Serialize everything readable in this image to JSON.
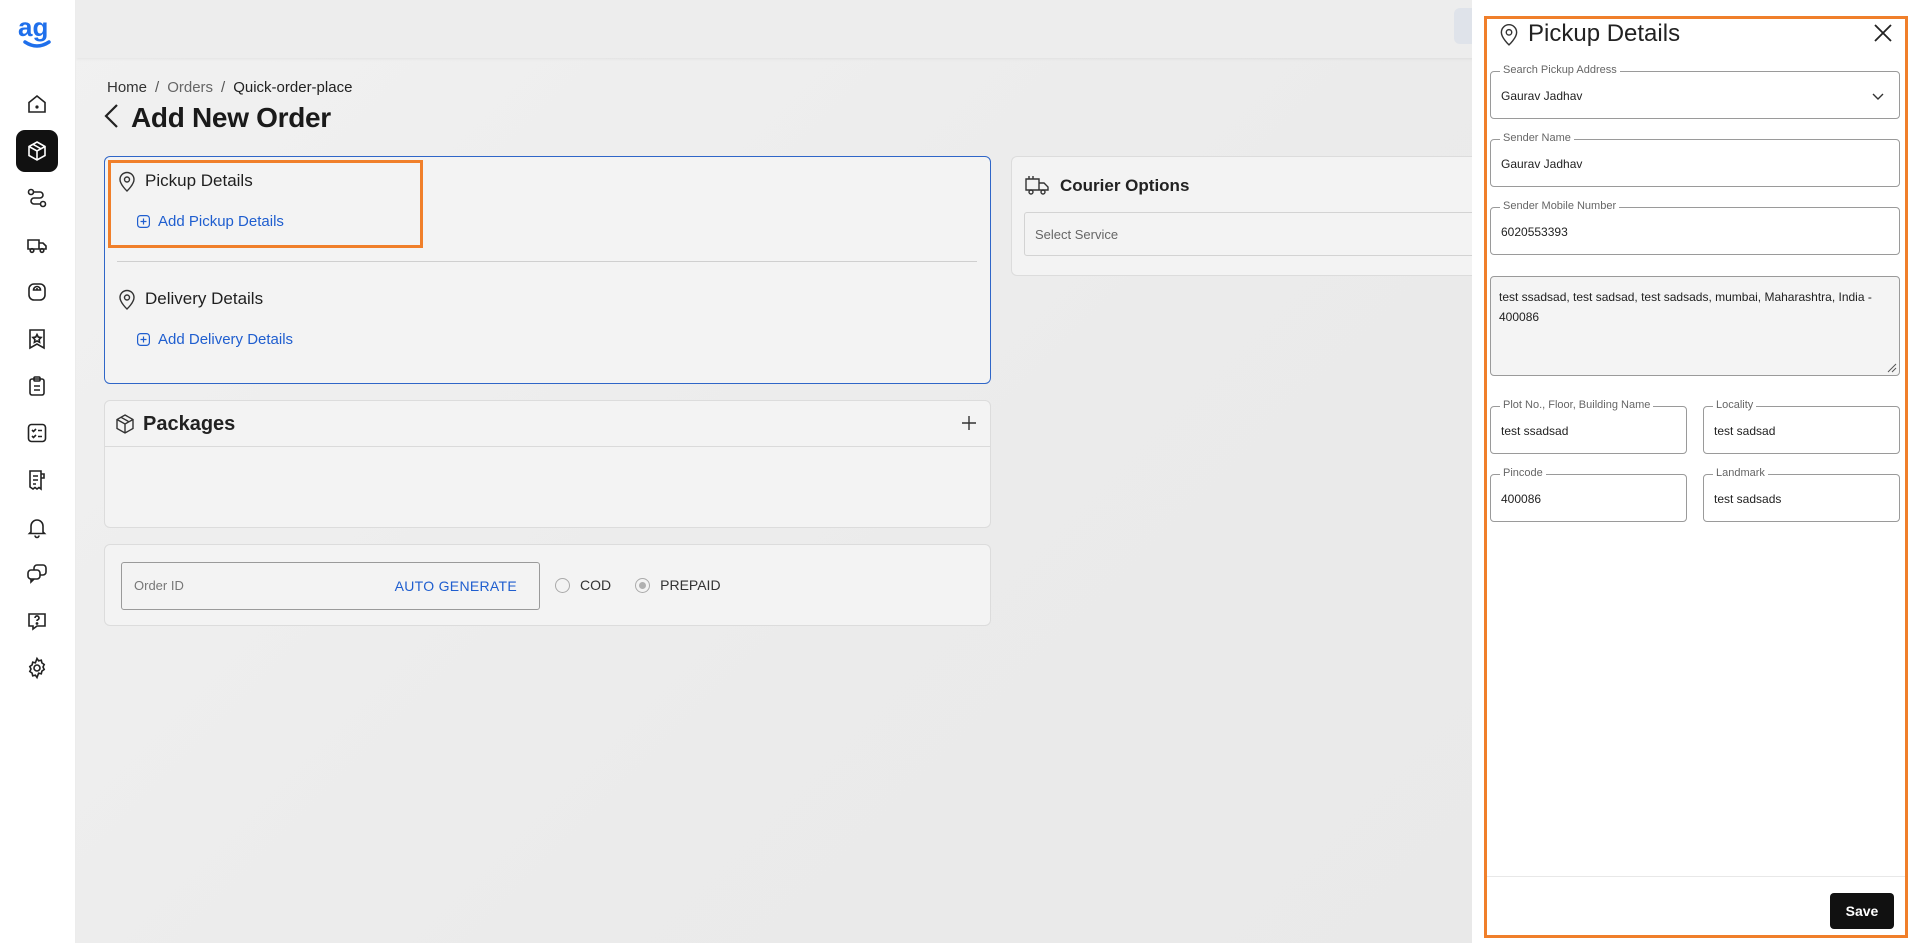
{
  "app": {
    "logo_text": "ag",
    "brand_color": "#1f6feb"
  },
  "sidebar": {
    "items": [
      {
        "name": "home",
        "icon": "home-icon",
        "active": false
      },
      {
        "name": "orders",
        "icon": "box-icon",
        "active": true
      },
      {
        "name": "routes",
        "icon": "route-icon",
        "active": false
      },
      {
        "name": "courier",
        "icon": "truck-icon",
        "active": false
      },
      {
        "name": "weight",
        "icon": "scale-icon",
        "active": false
      },
      {
        "name": "badge",
        "icon": "star-badge-icon",
        "active": false
      },
      {
        "name": "clipboard",
        "icon": "clipboard-icon",
        "active": false
      },
      {
        "name": "checklist",
        "icon": "checklist-icon",
        "active": false
      },
      {
        "name": "invoice",
        "icon": "receipt-icon",
        "active": false
      },
      {
        "name": "notifications",
        "icon": "bell-icon",
        "active": false
      },
      {
        "name": "chat",
        "icon": "chat-icon",
        "active": false
      },
      {
        "name": "help",
        "icon": "help-icon",
        "active": false
      },
      {
        "name": "settings",
        "icon": "gear-icon",
        "active": false
      }
    ]
  },
  "breadcrumb": {
    "home": "Home",
    "orders": "Orders",
    "current": "Quick-order-place",
    "separator": "/"
  },
  "page": {
    "title": "Add New Order"
  },
  "address": {
    "pickup_title": "Pickup Details",
    "pickup_add": "Add Pickup Details",
    "delivery_title": "Delivery Details",
    "delivery_add": "Add Delivery Details"
  },
  "packages": {
    "title": "Packages"
  },
  "order": {
    "id_placeholder": "Order ID",
    "auto_generate": "AUTO GENERATE",
    "cod_label": "COD",
    "prepaid_label": "PREPAID",
    "selected_payment": "PREPAID"
  },
  "courier": {
    "title": "Courier Options",
    "select_placeholder": "Select Service"
  },
  "drawer": {
    "title": "Pickup Details",
    "fields": {
      "search_address": {
        "label": "Search Pickup Address",
        "value": "Gaurav  Jadhav"
      },
      "sender_name": {
        "label": "Sender Name",
        "value": "Gaurav  Jadhav"
      },
      "sender_mobile": {
        "label": "Sender Mobile Number",
        "value": "6020553393"
      },
      "full_address": {
        "value": "test ssadsad, test sadsad, test sadsads, mumbai, Maharashtra, India - 400086"
      },
      "plot": {
        "label": "Plot No., Floor, Building Name",
        "value": "test ssadsad"
      },
      "locality": {
        "label": "Locality",
        "value": "test sadsad"
      },
      "pincode": {
        "label": "Pincode",
        "value": "400086"
      },
      "landmark": {
        "label": "Landmark",
        "value": "test sadsads"
      }
    },
    "save_label": "Save"
  },
  "colors": {
    "highlight": "#f07f2a",
    "link": "#1f5ecf",
    "active_nav": "#111111"
  }
}
